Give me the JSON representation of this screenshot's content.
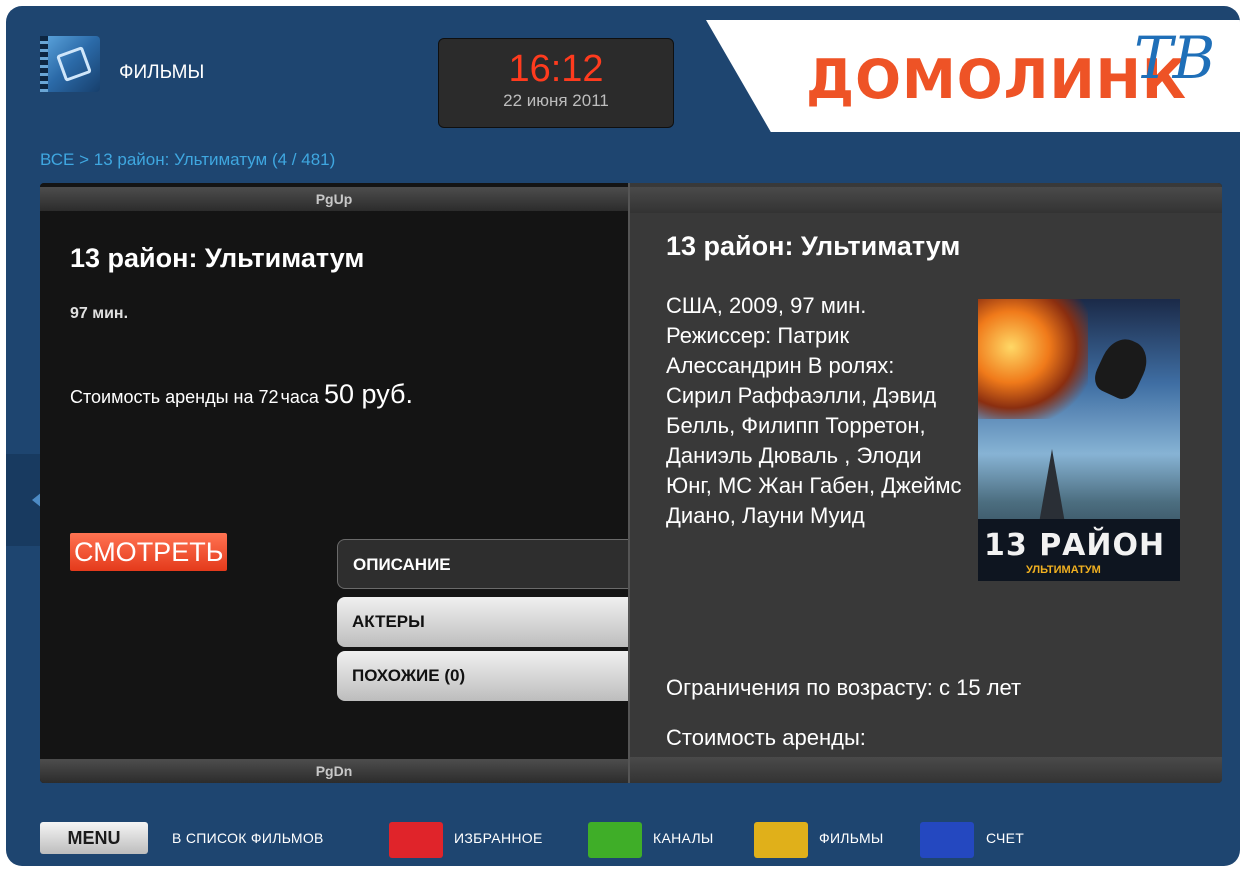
{
  "header": {
    "section_title": "ФИЛЬМЫ",
    "clock_time": "16:12",
    "clock_date": "22 июня 2011",
    "brand_name": "ДОМОЛИНК",
    "brand_tv": "ТВ"
  },
  "breadcrumb": "ВСЕ > 13 район: Ультиматум (4 / 481)",
  "left": {
    "pg_up": "PgUp",
    "pg_down": "PgDn",
    "title": "13 район: Ультиматум",
    "duration": "97 мин.",
    "rent_prefix": "Стоимость аренды на",
    "rent_hours": "72",
    "rent_hours_unit": "часа",
    "rent_price": "50 руб.",
    "watch_label": "СМОТРЕТЬ"
  },
  "tabs": [
    {
      "label": "ОПИСАНИЕ",
      "active": true
    },
    {
      "label": "АКТЕРЫ",
      "active": false
    },
    {
      "label": "ПОХОЖИЕ (0)",
      "active": false
    }
  ],
  "details": {
    "title": "13 район: Ультиматум",
    "description": "США, 2009, 97 мин. Режиссер: Патрик Алессандрин В ролях: Сирил Раффаэлли, Дэвид Белль, Филипп Торретон, Даниэль Дюваль , Элоди Юнг, МС Жан Габен, Джеймс Диано, Лауни Муид",
    "age_limit": "Ограничения по возрасту: с 15 лет",
    "cost_label": "Стоимость аренды:",
    "poster_title": "13 РАЙОН",
    "poster_subtitle": "УЛЬТИМАТУМ"
  },
  "footer": {
    "menu_label": "MENU",
    "menu_caption": "В СПИСОК ФИЛЬМОВ",
    "red_caption": "ИЗБРАННОЕ",
    "green_caption": "КАНАЛЫ",
    "yellow_caption": "ФИЛЬМЫ",
    "blue_caption": "СЧЕТ"
  },
  "colors": {
    "background": "#1e4570",
    "accent_red": "#e0242a",
    "accent_green": "#3fae28",
    "accent_yellow": "#e0b01a",
    "accent_blue": "#2448c0",
    "watch_button": "#e43a1b",
    "clock_time": "#ff3b1e",
    "brand": "#ee5326"
  },
  "icons": {
    "app_icon": "film-icon",
    "side_arrow": "chevron-left-icon"
  }
}
